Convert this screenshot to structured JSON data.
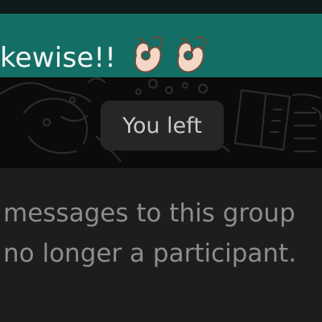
{
  "message": {
    "text": "kewise!!",
    "emoji_icons": [
      "ok-hand-icon",
      "ok-hand-icon"
    ]
  },
  "system_notice": {
    "text": "You left"
  },
  "footer": {
    "line1": "messages to this group",
    "line2": "no longer a participant."
  },
  "colors": {
    "bubble": "#136f66",
    "background": "#0b0b0b",
    "footer": "#1d1d1d",
    "footer_text": "#8d8d8d"
  }
}
